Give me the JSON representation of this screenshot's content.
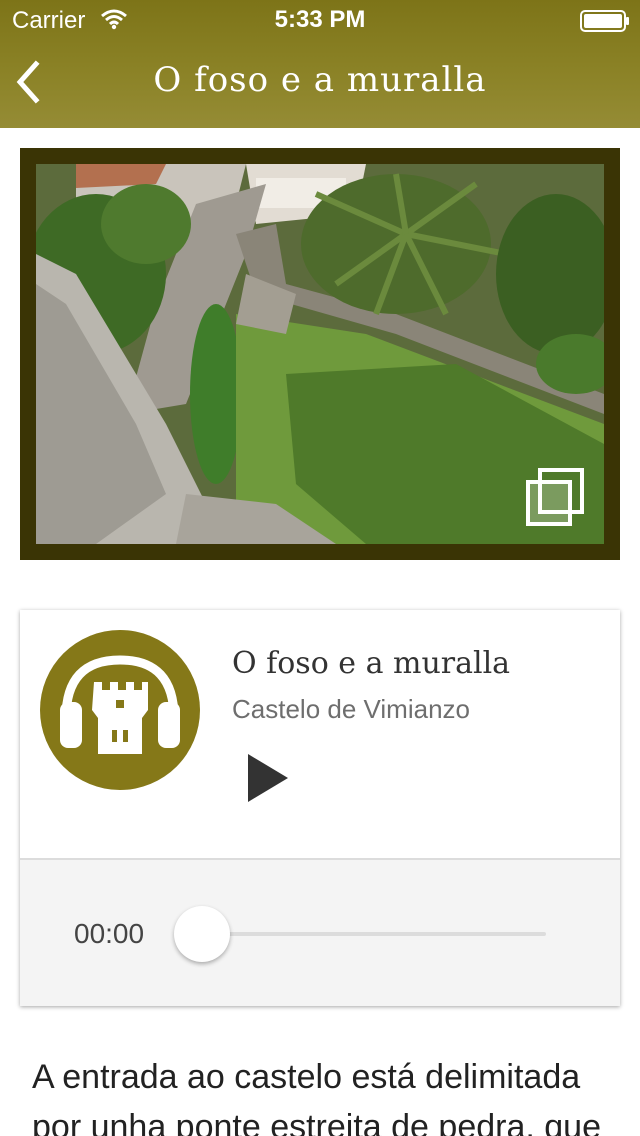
{
  "status_bar": {
    "carrier": "Carrier",
    "time": "5:33 PM",
    "wifi_icon": "wifi-icon",
    "battery_icon": "battery-icon"
  },
  "nav": {
    "back_icon": "chevron-left-icon",
    "title": "O foso e a muralla"
  },
  "photo": {
    "alt": "Castle moat and wall garden viewed from above",
    "gallery_icon": "gallery-stack-icon"
  },
  "audio": {
    "logo_icon": "castle-headphones-icon",
    "title": "O foso e a muralla",
    "subtitle": "Castelo de Vimianzo",
    "play_icon": "play-icon",
    "current_time": "00:00",
    "progress": 0
  },
  "description": "A entrada ao castelo está delimitada por unha ponte estreita de pedra, que",
  "colors": {
    "header": "#8b8226",
    "photo_frame": "#3a3405",
    "logo": "#857818"
  }
}
